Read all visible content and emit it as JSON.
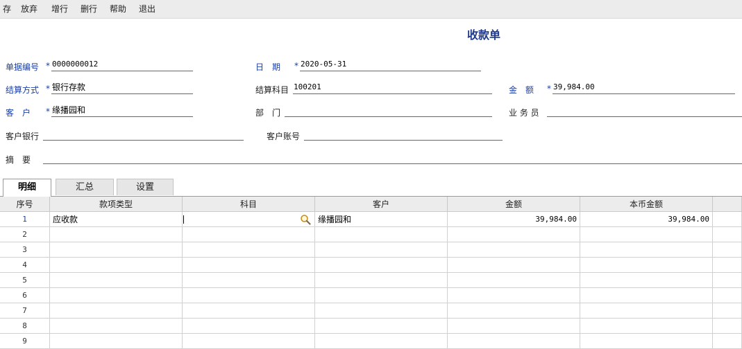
{
  "toolbar": {
    "buttons": [
      {
        "label": "存"
      },
      {
        "label": "放弃"
      },
      {
        "label": "增行"
      },
      {
        "label": "删行"
      },
      {
        "label": "帮助"
      },
      {
        "label": "退出"
      }
    ]
  },
  "title": "收款单",
  "form": {
    "doc_no": {
      "label": "单据编号",
      "value": "0000000012"
    },
    "date": {
      "label": "日　期",
      "value": "2020-05-31"
    },
    "settle_method": {
      "label": "结算方式",
      "value": "银行存款"
    },
    "settle_account": {
      "label": "结算科目",
      "value": "100201"
    },
    "amount": {
      "label": "金　额",
      "value": "39,984.00"
    },
    "customer": {
      "label": "客　户",
      "value": "缘播园和"
    },
    "department": {
      "label": "部　门",
      "value": ""
    },
    "salesperson": {
      "label": "业 务 员",
      "value": ""
    },
    "customer_bank": {
      "label": "客户银行",
      "value": ""
    },
    "customer_account": {
      "label": "客户账号",
      "value": ""
    },
    "summary": {
      "label": "摘　要",
      "value": ""
    },
    "required_mark": "*"
  },
  "tabs": [
    {
      "label": "明细"
    },
    {
      "label": "汇总"
    },
    {
      "label": "设置"
    }
  ],
  "table": {
    "columns": [
      "序号",
      "款项类型",
      "科目",
      "客户",
      "金额",
      "本币金额"
    ],
    "rows": [
      {
        "no": "1",
        "type": "应收款",
        "subject": "",
        "customer": "缘播园和",
        "amount": "39,984.00",
        "local_amount": "39,984.00"
      },
      {
        "no": "2",
        "type": "",
        "subject": "",
        "customer": "",
        "amount": "",
        "local_amount": ""
      },
      {
        "no": "3",
        "type": "",
        "subject": "",
        "customer": "",
        "amount": "",
        "local_amount": ""
      },
      {
        "no": "4",
        "type": "",
        "subject": "",
        "customer": "",
        "amount": "",
        "local_amount": ""
      },
      {
        "no": "5",
        "type": "",
        "subject": "",
        "customer": "",
        "amount": "",
        "local_amount": ""
      },
      {
        "no": "6",
        "type": "",
        "subject": "",
        "customer": "",
        "amount": "",
        "local_amount": ""
      },
      {
        "no": "7",
        "type": "",
        "subject": "",
        "customer": "",
        "amount": "",
        "local_amount": ""
      },
      {
        "no": "8",
        "type": "",
        "subject": "",
        "customer": "",
        "amount": "",
        "local_amount": ""
      },
      {
        "no": "9",
        "type": "",
        "subject": "",
        "customer": "",
        "amount": "",
        "local_amount": ""
      }
    ]
  },
  "icons": {
    "lookup": "magnifier-icon"
  },
  "colors": {
    "label_blue": "#1a3ea8",
    "title_blue": "#1f3a8a"
  }
}
